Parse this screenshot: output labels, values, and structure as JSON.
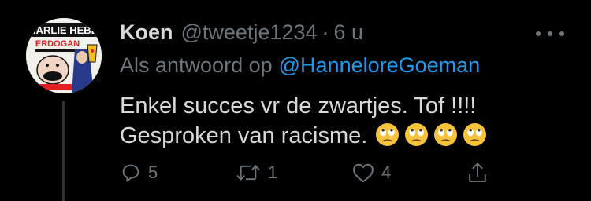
{
  "tweet": {
    "author": {
      "name": "Koen",
      "handle": "@tweetje1234",
      "separator": "·",
      "time": "6 u",
      "avatar": {
        "masthead": "CHARLIE HEBDO",
        "headline": "ERDOGAN",
        "colors": [
          "#f2f0ea",
          "#e02020",
          "#111111",
          "#f0c020"
        ]
      }
    },
    "reply_to": {
      "prefix": "Als antwoord op",
      "mention": "@HanneloreGoeman"
    },
    "body": {
      "line1": "Enkel succes vr de zwartjes. Tof !!!!",
      "line2": "Gesproken van racisme.",
      "emojis": [
        "face-with-rolling-eyes",
        "face-with-rolling-eyes",
        "face-with-rolling-eyes",
        "face-with-rolling-eyes"
      ]
    },
    "actions": {
      "reply": {
        "icon": "reply-icon",
        "count": "5"
      },
      "retweet": {
        "icon": "retweet-icon",
        "count": "1"
      },
      "like": {
        "icon": "heart-icon",
        "count": "4"
      },
      "share": {
        "icon": "share-icon",
        "count": ""
      }
    },
    "more_icon": "more-icon"
  },
  "colors": {
    "background": "#000000",
    "text": "#d9d9d9",
    "muted": "#6e767d",
    "accent": "#1d9bf0"
  }
}
